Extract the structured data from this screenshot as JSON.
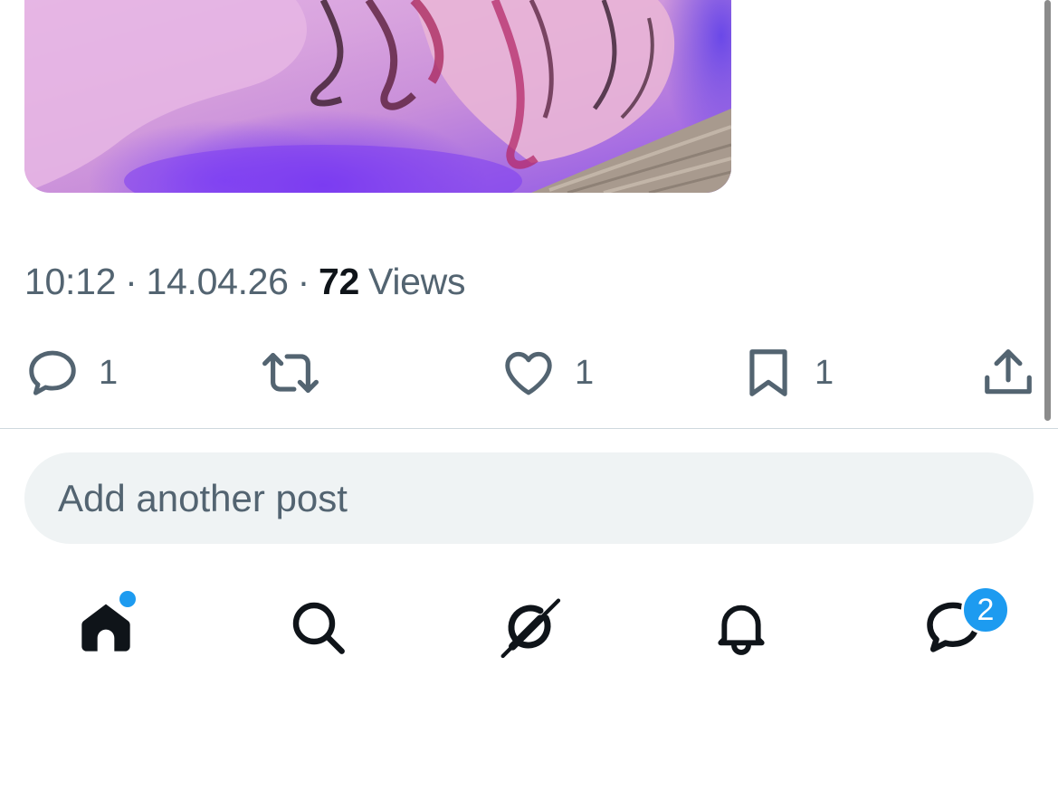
{
  "post": {
    "time": "10:12",
    "date": "14.04.26",
    "separator": "·",
    "views_count": "72",
    "views_label": "Views"
  },
  "actions": {
    "reply_count": "1",
    "repost_count": "",
    "like_count": "1",
    "bookmark_count": "1"
  },
  "compose": {
    "placeholder": "Add another post"
  },
  "nav": {
    "messages_badge": "2"
  },
  "colors": {
    "secondary_text": "#536471",
    "primary_text": "#0f1419",
    "accent": "#1d9bf0",
    "input_bg": "#eff3f4",
    "divider": "#cfd9de"
  },
  "icons": {
    "reply": "reply-icon",
    "repost": "repost-icon",
    "like": "heart-icon",
    "bookmark": "bookmark-icon",
    "share": "share-icon",
    "home": "home-icon",
    "search": "search-icon",
    "grok": "grok-icon",
    "notifications": "bell-icon",
    "messages": "messages-icon"
  }
}
